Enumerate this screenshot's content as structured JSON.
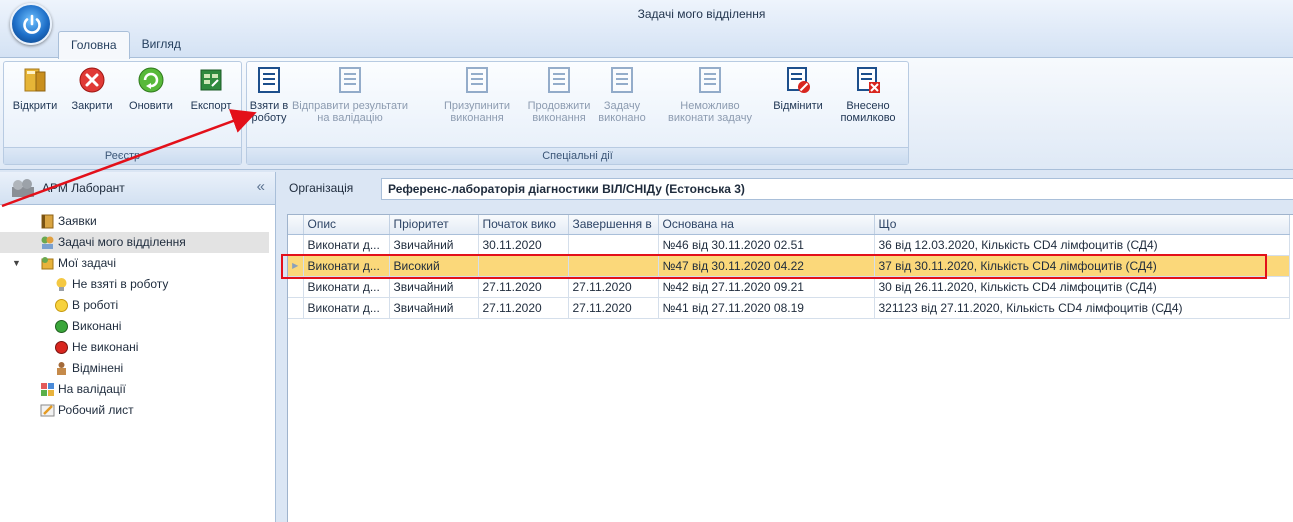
{
  "window": {
    "title": "Задачі мого відділення",
    "tabs": [
      {
        "label": "Головна",
        "active": true
      },
      {
        "label": "Вигляд",
        "active": false
      }
    ]
  },
  "ribbon": {
    "groups": [
      {
        "caption": "Реєстр",
        "buttons": [
          {
            "label": "Відкрити",
            "icon": "open-folder-icon",
            "enabled": true
          },
          {
            "label": "Закрити",
            "icon": "close-red-icon",
            "enabled": true
          },
          {
            "label": "Оновити",
            "icon": "refresh-green-icon",
            "enabled": true
          },
          {
            "label": "Експорт",
            "icon": "export-sheet-icon",
            "enabled": true
          }
        ]
      },
      {
        "caption": "Спеціальні дії",
        "buttons": [
          {
            "label": "Взяти в",
            "label2": "роботу",
            "icon": "task-list-icon",
            "enabled": true
          },
          {
            "label": "Відправити результати",
            "label2": "на валідацію",
            "icon": "task-list-icon",
            "enabled": false
          },
          {
            "label": "Призупинити",
            "label2": "виконання",
            "icon": "task-list-icon",
            "enabled": false
          },
          {
            "label": "Продовжити",
            "label2": "виконання",
            "icon": "task-list-icon",
            "enabled": false
          },
          {
            "label": "Задачу",
            "label2": "виконано",
            "icon": "task-list-icon",
            "enabled": false
          },
          {
            "label": "Неможливо",
            "label2": "виконати задачу",
            "icon": "task-list-icon",
            "enabled": false
          },
          {
            "label": "Відмінити",
            "label2": "",
            "icon": "task-cancel-icon",
            "enabled": true
          },
          {
            "label": "Внесено",
            "label2": "помилково",
            "icon": "task-error-icon",
            "enabled": true
          }
        ]
      }
    ]
  },
  "leftpanel": {
    "title": "АРМ Лаборант",
    "collapse_glyph": "«",
    "tree": [
      {
        "label": "Заявки",
        "icon": "requests-icon",
        "level": 0,
        "selected": false
      },
      {
        "label": "Задачі мого відділення",
        "icon": "department-tasks-icon",
        "level": 0,
        "selected": true
      },
      {
        "label": "Мої задачі",
        "icon": "my-tasks-icon",
        "level": 0,
        "selected": false,
        "expanded": true
      },
      {
        "label": "Не взяті в роботу",
        "icon": "bulb-icon",
        "level": 1,
        "selected": false
      },
      {
        "label": "В роботі",
        "icon": "yellow-dot-icon",
        "level": 1,
        "selected": false
      },
      {
        "label": "Виконані",
        "icon": "green-dot-icon",
        "level": 1,
        "selected": false
      },
      {
        "label": "Не виконані",
        "icon": "red-dot-icon",
        "level": 1,
        "selected": false
      },
      {
        "label": "Відмінені",
        "icon": "cancelled-icon",
        "level": 1,
        "selected": false
      },
      {
        "label": "На валідації",
        "icon": "validation-icon",
        "level": 0,
        "selected": false
      },
      {
        "label": "Робочий лист",
        "icon": "worksheet-icon",
        "level": 0,
        "selected": false
      }
    ]
  },
  "organization": {
    "label": "Організація",
    "value": "Референс-лабораторія діагностики ВІЛ/СНІДу (Естонська 3)"
  },
  "grid": {
    "columns": [
      "Опис",
      "Пріоритет",
      "Початок вико",
      "Завершення в",
      "Основана на",
      "Що"
    ],
    "rows": [
      [
        "Виконати д...",
        "Звичайний",
        "30.11.2020",
        "",
        "№46 від 30.11.2020 02.51",
        "36 від 12.03.2020, Кількість CD4 лімфоцитів (СД4)"
      ],
      [
        "Виконати д...",
        "Високий",
        "",
        "",
        "№47 від 30.11.2020 04.22",
        "37 від 30.11.2020, Кількість CD4 лімфоцитів (СД4)"
      ],
      [
        "Виконати д...",
        "Звичайний",
        "27.11.2020",
        "27.11.2020",
        "№42 від 27.11.2020 09.21",
        "30 від 26.11.2020, Кількість CD4 лімфоцитів (СД4)"
      ],
      [
        "Виконати д...",
        "Звичайний",
        "27.11.2020",
        "27.11.2020",
        "№41 від 27.11.2020 08.19",
        "321123 від 27.11.2020, Кількість CD4 лімфоцитів (СД4)"
      ]
    ],
    "focused_row": 1
  },
  "colors": {
    "annotation_red": "#e3101a",
    "focused_row": "#fbd87a",
    "accent_blue": "#1d6ec7"
  }
}
